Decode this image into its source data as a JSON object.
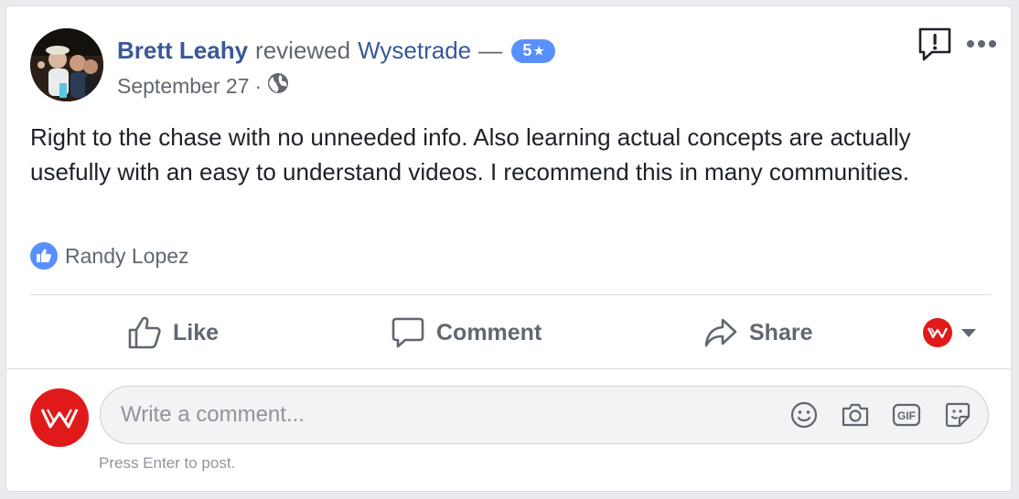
{
  "post": {
    "author": "Brett Leahy",
    "verb": "reviewed",
    "page": "Wysetrade",
    "dash": "—",
    "rating": "5",
    "rating_star": "★",
    "date": "September 27",
    "dot": "·",
    "audience_icon": "globe-icon",
    "text": "Right to the chase with no unneeded info. Also learning actual concepts are actually usefully with an easy to understand videos. I recommend this in many communities."
  },
  "reactions": {
    "type_icon": "like-icon",
    "names": "Randy Lopez"
  },
  "actions": {
    "like": "Like",
    "comment": "Comment",
    "share": "Share"
  },
  "comment_composer": {
    "placeholder": "Write a comment...",
    "hint": "Press Enter to post.",
    "icons": [
      "emoji-icon",
      "camera-icon",
      "gif-icon",
      "sticker-icon"
    ]
  },
  "colors": {
    "link": "#385898",
    "accent": "#5890ff",
    "brand_red": "#e01a1a",
    "muted": "#606770"
  }
}
